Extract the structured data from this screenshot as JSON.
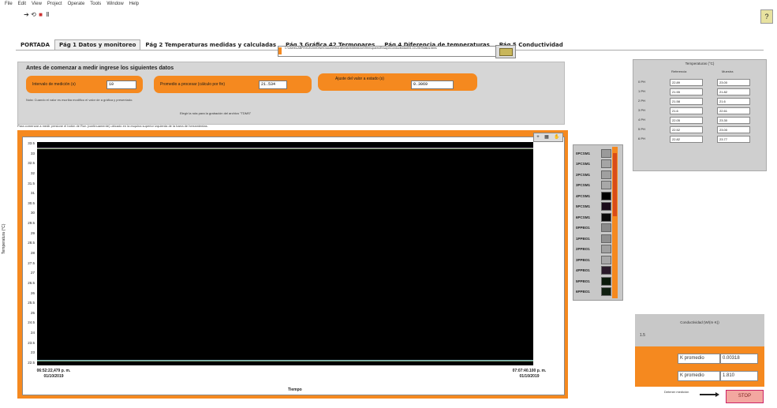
{
  "menu": [
    "File",
    "Edit",
    "View",
    "Project",
    "Operate",
    "Tools",
    "Window",
    "Help"
  ],
  "tabs": [
    {
      "label": "PORTADA",
      "active": false
    },
    {
      "label": "Pág 1 Datos y monitoreo",
      "active": true
    },
    {
      "label": "Pág 2 Temperaturas medidas y calculadas",
      "active": false
    },
    {
      "label": "Pág 3 Gráfica 42 Termopares",
      "active": false
    },
    {
      "label": "Pág 4 Diferencia de temperaturas",
      "active": false
    },
    {
      "label": "Pág 5 Conductividad",
      "active": false
    }
  ],
  "setup": {
    "title": "Antes de comenzar a medir ingrese los siguientes datos",
    "interval_label": "Intervalo de medición (s)",
    "interval_value": "10",
    "average_label": "Promedio a procesar (cálculo por fin)",
    "average_value": "21.534",
    "third_label": "Ajuste del valor a estado (s)",
    "third_value": "0.3069",
    "note": "Nota: Cuando el valor es escriba modifico el valor de a gráfica y presentado.",
    "path_label": "Elegir la ruta para la grabación del archivo \"TDMS\"",
    "path_value": "C:\\Users\\LABFISICA\\OneDrive\\Documents\\Laboratorio\\Medicion\\Termopares\\Ensayo\\Conductividad\\01-10-2019\\datos.tdms",
    "sub_note": "Para comenzar a medir presione el botón de Run (continuamente) ubicado en la esquina superior izquierda de la barra de herramientas."
  },
  "graph": {
    "y_label": "Temperatura (°C)",
    "x_label": "Tiempo",
    "y_ticks": [
      "33.5",
      "33",
      "32.5",
      "32",
      "31.5",
      "31",
      "30.5",
      "30",
      "29.5",
      "29",
      "28.5",
      "28",
      "27.5",
      "27",
      "26.5",
      "26",
      "25.5",
      "25",
      "24.5",
      "24",
      "23.5",
      "23",
      "22.5"
    ],
    "x_start": {
      "time": "06:52:22,479 p. m.",
      "date": "01/10/2019"
    },
    "x_end": {
      "time": "07:07:40.100 p. m.",
      "date": "01/10/2019"
    }
  },
  "chart_data": {
    "type": "line",
    "ylabel": "Temperatura (°C)",
    "xlabel": "Tiempo",
    "ylim": [
      22.5,
      33.5
    ],
    "x": [
      "06:52:22,479 p. m.",
      "07:07:40.100 p. m."
    ],
    "series": [
      {
        "name": "0PCSM1",
        "values": [
          33.2,
          33.2
        ],
        "color": "#b070d0"
      },
      {
        "name": "1PCSM1",
        "values": [
          33.18,
          33.18
        ],
        "color": "#9ec08a"
      },
      {
        "name": "2PCSM1",
        "values": [
          22.75,
          22.75
        ],
        "color": "#6fa8c0"
      },
      {
        "name": "3PCSM1",
        "values": [
          22.72,
          22.72
        ],
        "color": "#88b088"
      }
    ]
  },
  "legend": [
    {
      "name": "0PCSM1",
      "color": "#9a9a9a"
    },
    {
      "name": "1PCSM1",
      "color": "#a5a5a5"
    },
    {
      "name": "2PCSM1",
      "color": "#a0a0a0"
    },
    {
      "name": "3PCSM1",
      "color": "#a8a8a8"
    },
    {
      "name": "4PCSM1",
      "color": "#000000"
    },
    {
      "name": "5PCSM1",
      "color": "#1a0a1a"
    },
    {
      "name": "6PCSM1",
      "color": "#0a0a0a"
    },
    {
      "name": "0PPBO1",
      "color": "#8a8a8a"
    },
    {
      "name": "1PPBO1",
      "color": "#909090"
    },
    {
      "name": "2PPBO1",
      "color": "#a0a0a0"
    },
    {
      "name": "3PPBO1",
      "color": "#a8a8a8"
    },
    {
      "name": "4PPBO1",
      "color": "#2a1a2a"
    },
    {
      "name": "5PPBO1",
      "color": "#0a1a0a"
    },
    {
      "name": "6PPBO1",
      "color": "#102010"
    }
  ],
  "temps": {
    "title": "Temperaturas (°C)",
    "col1": "Referencia",
    "col2": "Muestra",
    "rows": [
      {
        "label": "0 PH",
        "a": "22.89",
        "b": "23.00"
      },
      {
        "label": "1 PH",
        "a": "21.55",
        "b": "21.82"
      },
      {
        "label": "2 PH",
        "a": "21.58",
        "b": "21.6"
      },
      {
        "label": "3 PH",
        "a": "21.6",
        "b": "22.61"
      },
      {
        "label": "4 PH",
        "a": "22.05",
        "b": "23.30"
      },
      {
        "label": "5 PH",
        "a": "22.52",
        "b": "23.00"
      },
      {
        "label": "6 PH",
        "a": "22.82",
        "b": "23.77"
      }
    ]
  },
  "cond": {
    "title": "Conductividad (W/(m·K))",
    "value": "1.5",
    "row1_label": "K promedio",
    "row1_value": "0.00318",
    "row2_label": "K promedio",
    "row2_value": "1.810"
  },
  "bottom_note": "Detener medición",
  "stop_label": "STOP"
}
